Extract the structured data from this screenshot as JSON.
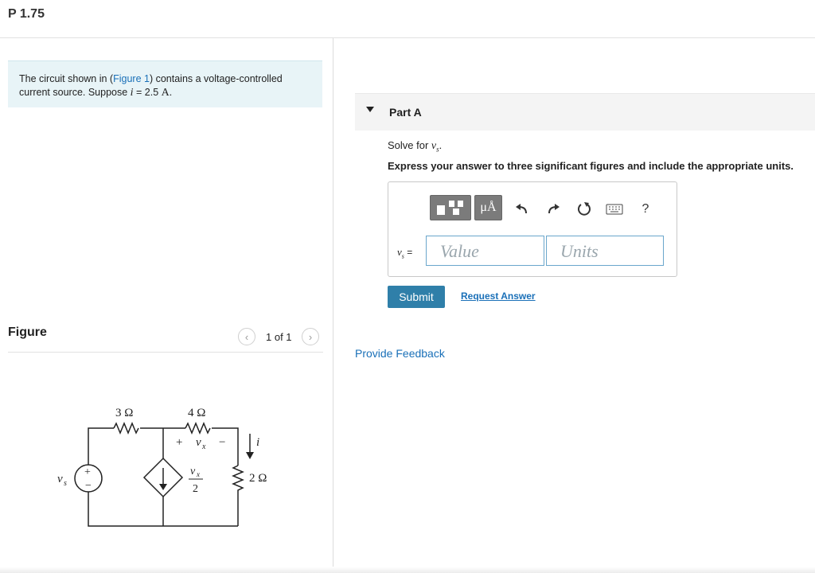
{
  "header": {
    "title": "P 1.75"
  },
  "problem": {
    "prefix": "The circuit shown in (",
    "link": "Figure 1",
    "suffix": ") contains a voltage-controlled current source. Suppose ",
    "var": "i",
    "eq": " = 2.5 ",
    "unit": "A",
    "end": "."
  },
  "figure": {
    "label": "Figure",
    "pager": "1 of 1",
    "circuit": {
      "r1": "3 Ω",
      "r2": "4 Ω",
      "r3": "2 Ω",
      "vs_label": "v",
      "vs_sub": "s",
      "vx_plus": "+",
      "vx_label": "v",
      "vx_sub": "x",
      "vx_minus": "−",
      "current_label": "i",
      "src_num": "v",
      "src_num_sub": "x",
      "src_den": "2",
      "plus": "+",
      "minus": "−"
    }
  },
  "partA": {
    "label": "Part A",
    "solve_prefix": "Solve for ",
    "solve_var": "v",
    "solve_sub": "s",
    "solve_end": ".",
    "instruction": "Express your answer to three significant figures and include the appropriate units.",
    "toolbar": {
      "units_button": "μÅ",
      "help": "?",
      "icons": [
        "templates-icon",
        "units-icon",
        "undo-icon",
        "redo-icon",
        "reset-icon",
        "keyboard-icon",
        "help-icon"
      ]
    },
    "answer_label": "vs =",
    "answer_var": "v",
    "answer_sub": "s",
    "answer_eq": " =",
    "value_placeholder": "Value",
    "units_placeholder": "Units",
    "submit": "Submit",
    "request": "Request Answer"
  },
  "feedback": "Provide Feedback",
  "colors": {
    "link": "#1a70b8",
    "submit_bg": "#2f7fa9",
    "problem_bg": "#e8f4f7"
  }
}
